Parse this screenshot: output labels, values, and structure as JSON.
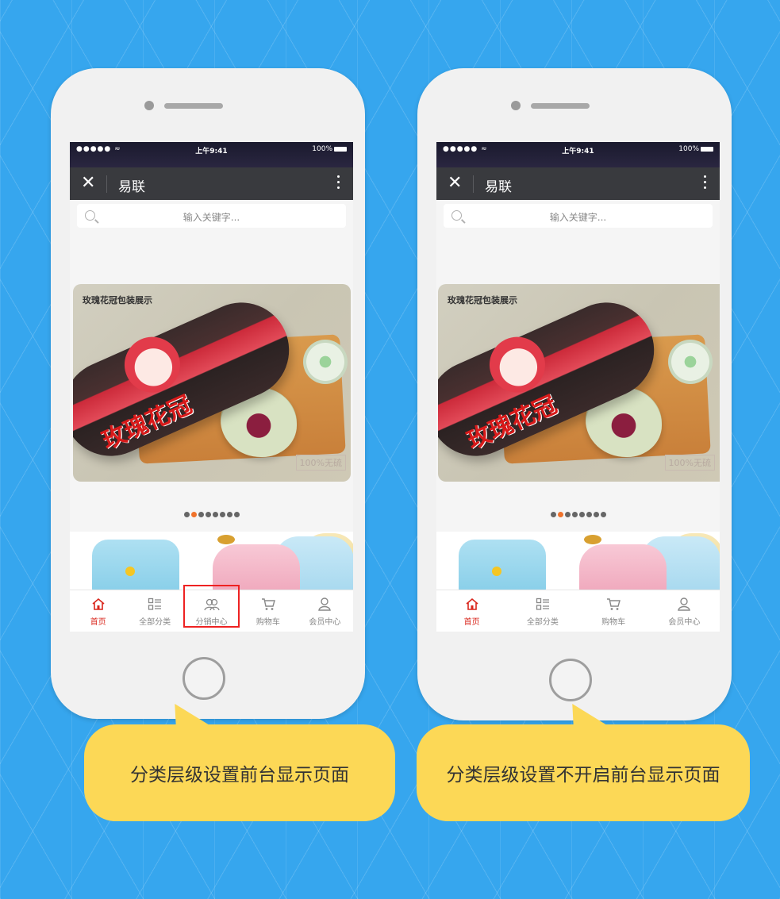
{
  "colors": {
    "background": "#36a6ee",
    "navbar": "#393a3e",
    "active_tab": "#d9261c",
    "bubble": "#fcd856",
    "highlight_box": "#e22222",
    "dot_active": "#f0722b"
  },
  "phones": [
    {
      "status": {
        "signal": "●●●●● ≈",
        "time": "上午9:41",
        "battery": "100%"
      },
      "navbar": {
        "close_icon": "close-icon",
        "title": "易联",
        "more_icon": "more-vertical-icon"
      },
      "search": {
        "placeholder": "输入关键字..."
      },
      "banner": {
        "title": "玫瑰花冠包装展示",
        "can_text": "玫瑰花冠",
        "stamp": "100%无硫"
      },
      "carousel": {
        "count": 8,
        "active_index": 1
      },
      "tabs": [
        {
          "label": "首页",
          "icon": "home-icon",
          "active": true
        },
        {
          "label": "全部分类",
          "icon": "category-icon",
          "active": false
        },
        {
          "label": "分销中心",
          "icon": "distribution-icon",
          "active": false,
          "highlighted": true
        },
        {
          "label": "购物车",
          "icon": "cart-icon",
          "active": false
        },
        {
          "label": "会员中心",
          "icon": "user-icon",
          "active": false
        }
      ]
    },
    {
      "status": {
        "signal": "●●●●● ≈",
        "time": "上午9:41",
        "battery": "100%"
      },
      "navbar": {
        "close_icon": "close-icon",
        "title": "易联",
        "more_icon": "more-vertical-icon"
      },
      "search": {
        "placeholder": "输入关键字..."
      },
      "banner": {
        "title": "玫瑰花冠包装展示",
        "can_text": "玫瑰花冠",
        "stamp": "100%无硫"
      },
      "carousel": {
        "count": 8,
        "active_index": 1
      },
      "tabs": [
        {
          "label": "首页",
          "icon": "home-icon",
          "active": true
        },
        {
          "label": "全部分类",
          "icon": "category-icon",
          "active": false
        },
        {
          "label": "购物车",
          "icon": "cart-icon",
          "active": false
        },
        {
          "label": "会员中心",
          "icon": "user-icon",
          "active": false
        }
      ]
    }
  ],
  "captions": {
    "left": "分类层级设置前台显示页面",
    "right": "分类层级设置不开启前台显示页面"
  }
}
